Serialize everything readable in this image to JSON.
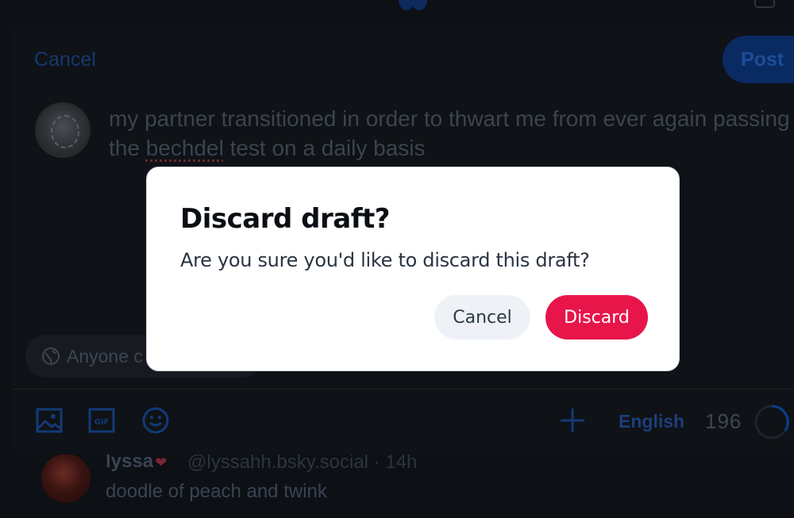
{
  "composer": {
    "cancel_label": "Cancel",
    "post_label": "Post",
    "text_before": "my partner transitioned in order to thwart me from ever again passing the ",
    "misspelled_word": "bechdel",
    "text_after": " test on a daily basis",
    "audience_label": "Anyone c",
    "language_label": "English",
    "char_count": "196"
  },
  "feed": {
    "author": "lyssa",
    "handle": "@lyssahh.bsky.social · 14h",
    "text": "doodle of peach and twink"
  },
  "dialog": {
    "title": "Discard draft?",
    "message": "Are you sure you'd like to discard this draft?",
    "cancel_label": "Cancel",
    "discard_label": "Discard"
  },
  "colors": {
    "discard": "#e8154a",
    "accent": "#1083fe"
  }
}
